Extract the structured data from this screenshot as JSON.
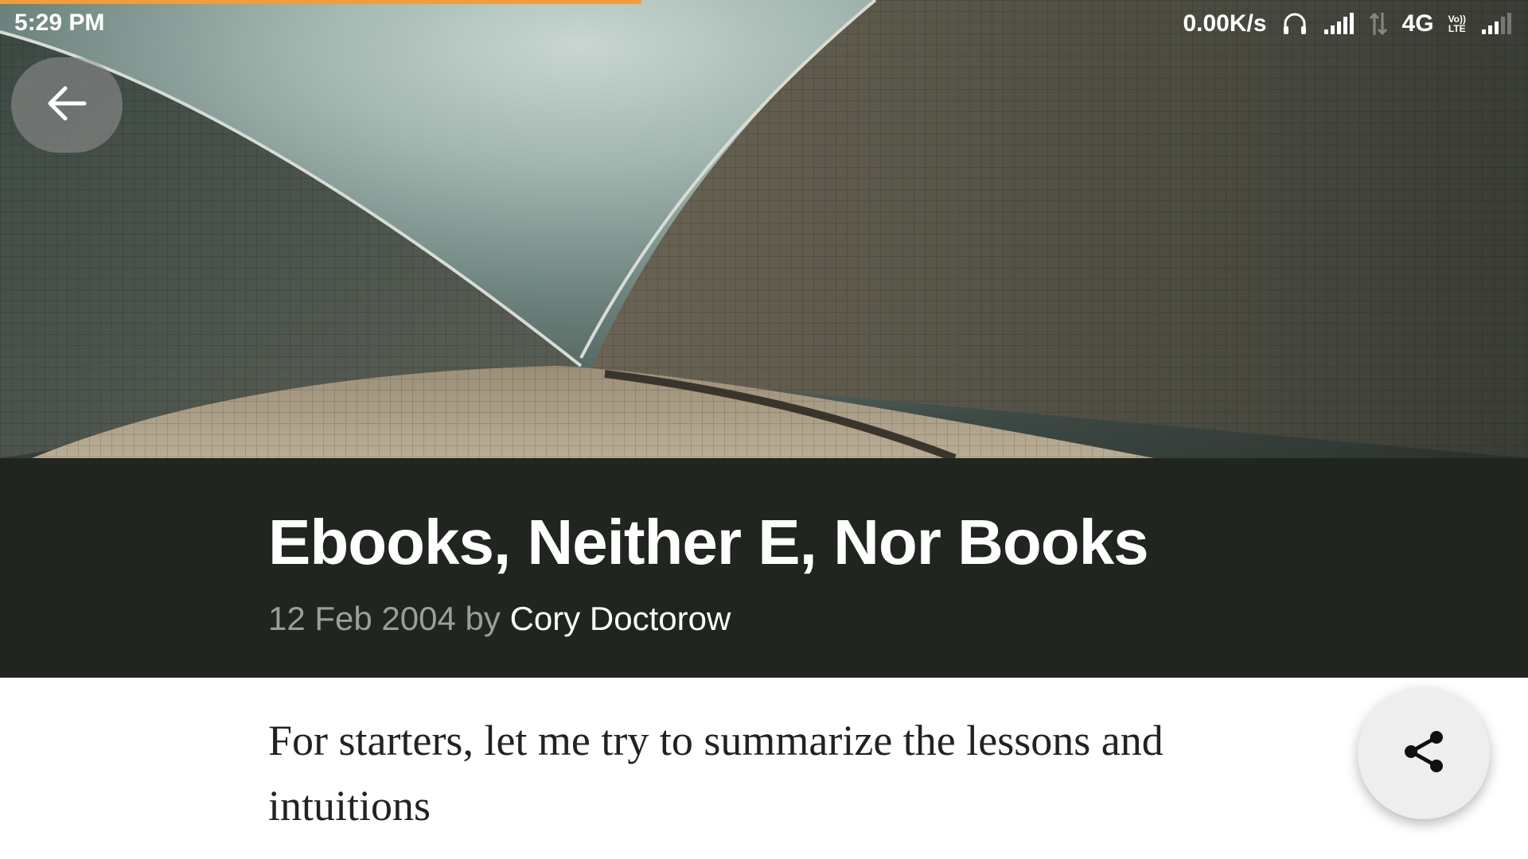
{
  "status_bar": {
    "time": "5:29 PM",
    "net_speed": "0.00K/s",
    "network_type": "4G",
    "volte_top": "Vo))",
    "volte_bottom": "LTE"
  },
  "reading_progress": 0.42,
  "article": {
    "title": "Ebooks, Neither E, Nor Books",
    "date": "12 Feb 2004",
    "by": "by",
    "author": "Cory Doctorow",
    "body_line_1": "For starters, let me try to summarize the lessons and",
    "body_line_2": "intuitions"
  },
  "colors": {
    "accent": "#f39c3a",
    "title_band": "#20251f",
    "byline": "#9a9f99"
  },
  "icons": {
    "back": "arrow-left-icon",
    "share": "share-icon",
    "headphones": "headphones-icon",
    "signal": "signal-icon",
    "data": "data-arrows-icon"
  }
}
